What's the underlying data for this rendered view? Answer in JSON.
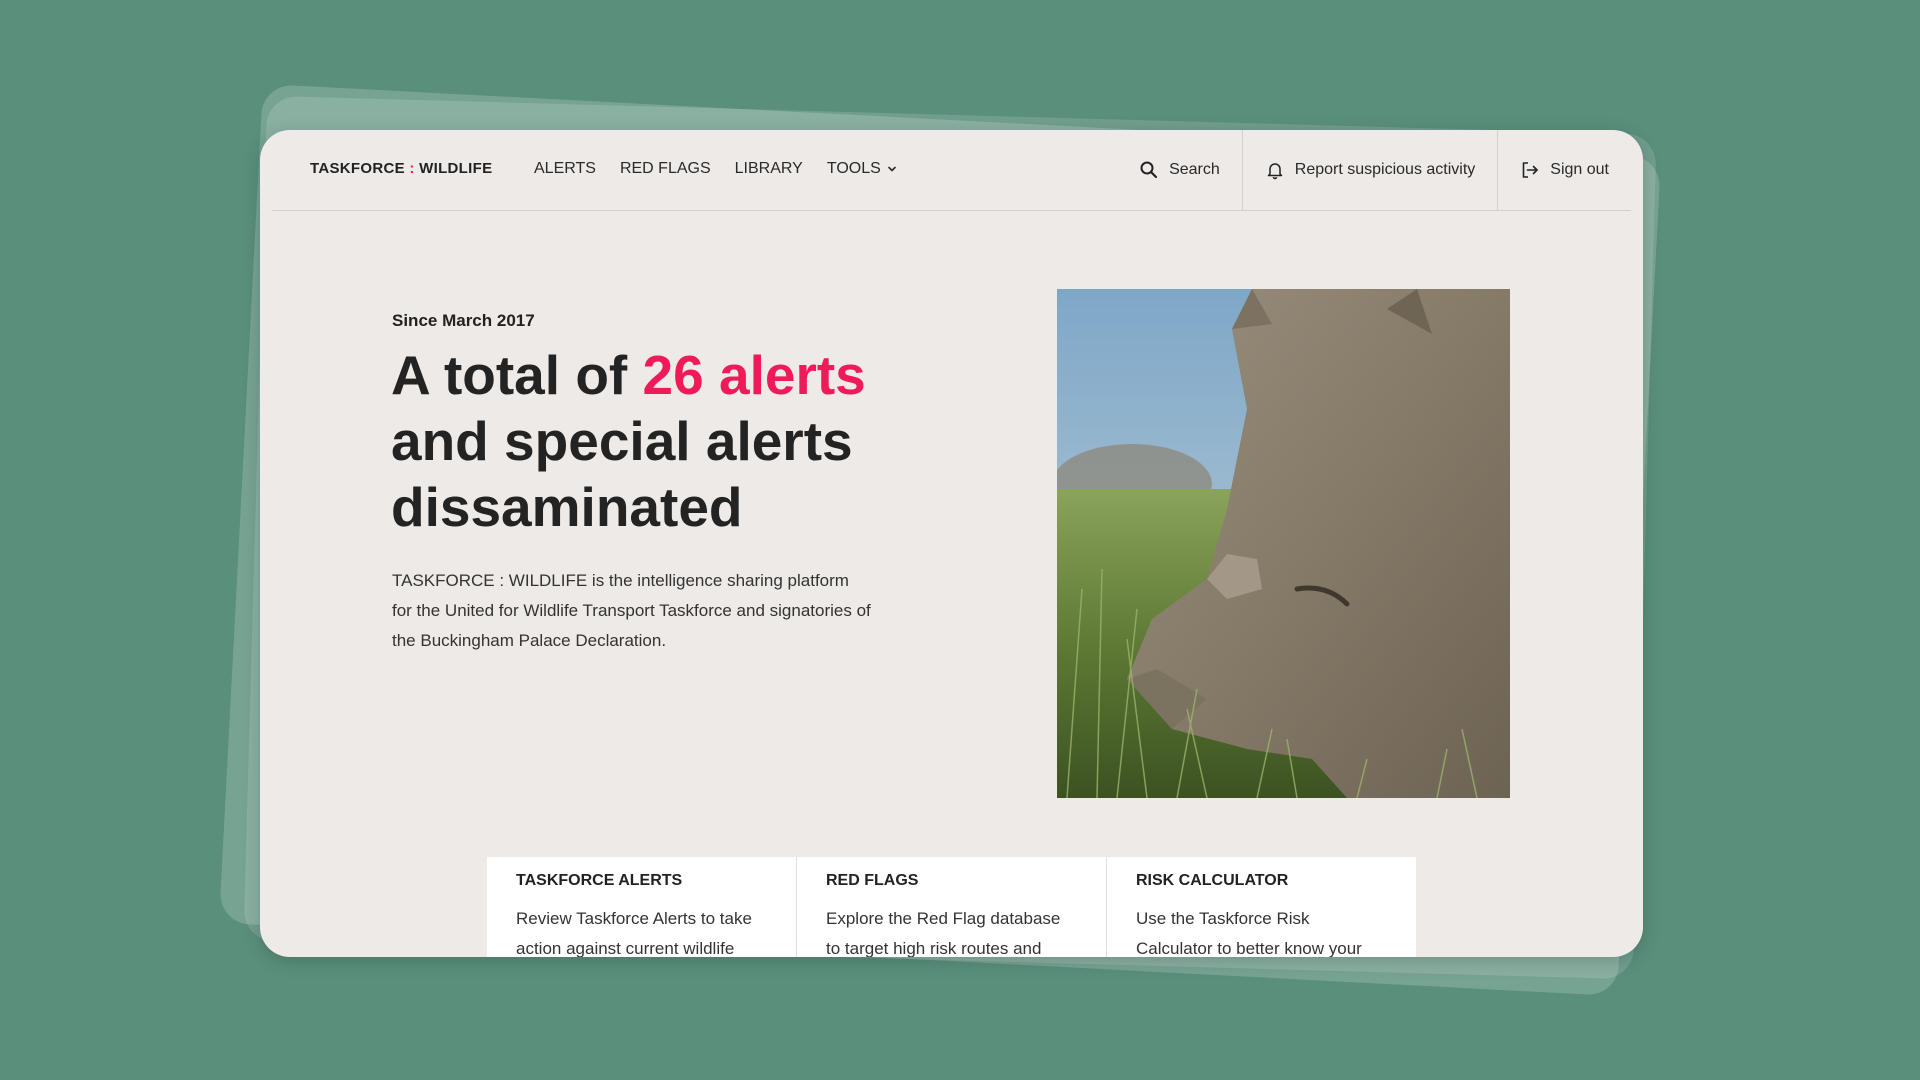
{
  "brand": {
    "left": "TASKFORCE",
    "separator": ":",
    "right": "WILDLIFE"
  },
  "nav": {
    "links": [
      "ALERTS",
      "RED FLAGS",
      "LIBRARY",
      "TOOLS"
    ],
    "search_label": "Search",
    "report_label": "Report suspicious activity",
    "signout_label": "Sign out"
  },
  "hero": {
    "since": "Since March 2017",
    "headline_prefix": "A total of ",
    "headline_highlight": "26 alerts",
    "headline_suffix": "and special alerts dissaminated",
    "description": "TASKFORCE : WILDLIFE is the intelligence sharing platform for the United for Wildlife Transport Taskforce and signatories of the Buckingham Palace Declaration."
  },
  "cards": [
    {
      "title": "TASKFORCE ALERTS",
      "text": "Review Taskforce Alerts to take action against current wildlife"
    },
    {
      "title": "RED FLAGS",
      "text": "Explore the Red Flag database to target high risk routes and"
    },
    {
      "title": "RISK CALCULATOR",
      "text": "Use the Taskforce Risk Calculator to better know your"
    }
  ],
  "colors": {
    "background": "#5a8f7c",
    "panel": "#eeeae7",
    "accent": "#ee1b58"
  }
}
